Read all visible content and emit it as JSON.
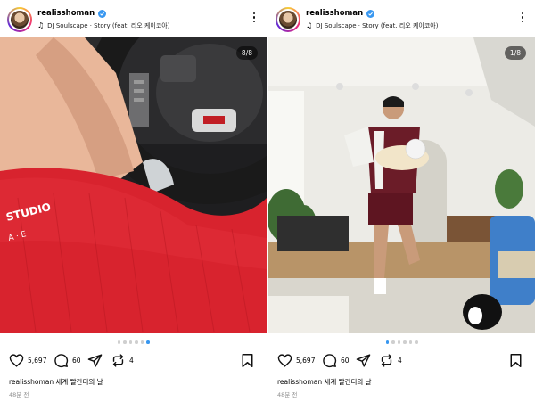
{
  "posts": [
    {
      "username": "realisshoman",
      "music": "DJ Soulscape · Story (feat. 리오 케이코아)",
      "counter": "8/8",
      "likes": "5,697",
      "comments": "60",
      "reposts": "4",
      "caption_user": "realisshoman",
      "caption_text": "세계 빨간디의 날",
      "time": "48분 전",
      "dots_total": 6,
      "dots_active_index": 5,
      "photo_colors": {
        "shorts": "#d8232e",
        "interior": "#2a2a2c",
        "skin": "#e9b79a"
      }
    },
    {
      "username": "realisshoman",
      "music": "DJ Soulscape · Story (feat. 리오 케이코아)",
      "counter": "1/8",
      "likes": "5,697",
      "comments": "60",
      "reposts": "4",
      "caption_user": "realisshoman",
      "caption_text": "세계 빨간디의 날",
      "time": "48분 전",
      "dots_total": 6,
      "dots_active_index": 0,
      "photo_colors": {
        "wall": "#ecebe6",
        "floor": "#b89468",
        "shorts": "#6b1c28"
      }
    }
  ],
  "colors": {
    "accent": "#3897f0",
    "verified": "#3897f0"
  },
  "icons": [
    "heart-icon",
    "comment-icon",
    "share-icon",
    "repost-icon",
    "bookmark-icon",
    "music-note-icon",
    "more-icon",
    "verified-icon"
  ]
}
